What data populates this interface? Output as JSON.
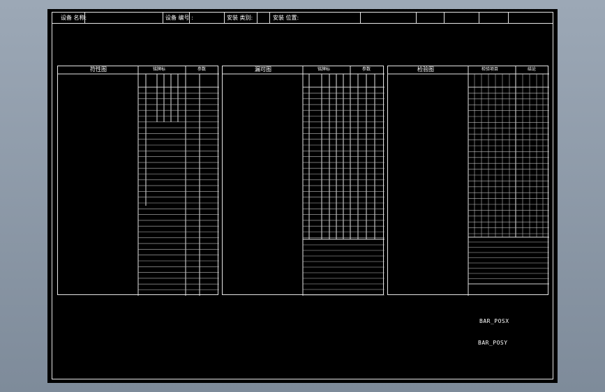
{
  "header": {
    "field1": "设备 名称:",
    "field2": "设备 编号 :",
    "field3": "安装 类别:",
    "field4": "安装 位置:"
  },
  "panels": {
    "left": {
      "title": "符性图",
      "group1": "铭牌标",
      "group2": "参数"
    },
    "middle": {
      "title": "漏可图",
      "group1": "铭牌标",
      "group2": "参数"
    },
    "right": {
      "title": "检验图",
      "group1": "检验项目",
      "group2": "结论"
    }
  },
  "labels": {
    "bar_posx": "BAR_POSX",
    "bar_posy": "BAR_POSY"
  }
}
